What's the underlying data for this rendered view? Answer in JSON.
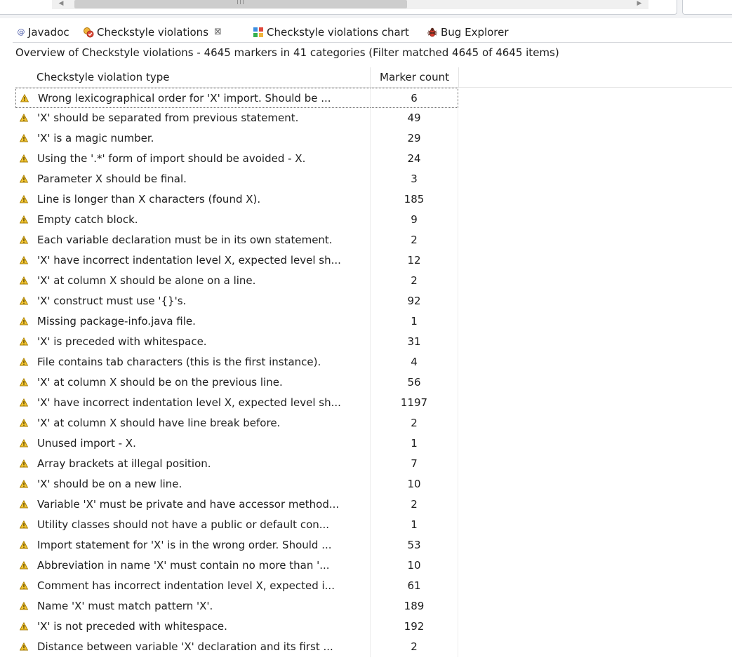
{
  "tabs": [
    {
      "label": "Javadoc",
      "icon": "at-sign-icon"
    },
    {
      "label": "Checkstyle violations",
      "icon": "checkstyle-icon",
      "active": true,
      "close": "⊠"
    },
    {
      "label": "Checkstyle violations chart",
      "icon": "chart-icon"
    },
    {
      "label": "Bug Explorer",
      "icon": "bug-icon"
    }
  ],
  "summary": "Overview of Checkstyle violations - 4645 markers in 41 categories (Filter matched 4645 of 4645 items)",
  "table": {
    "columns": [
      "Checkstyle violation type",
      "Marker count"
    ],
    "rows": [
      {
        "type": "Wrong lexicographical order for 'X' import. Should be ...",
        "count": "6"
      },
      {
        "type": "'X' should be separated from previous statement.",
        "count": "49"
      },
      {
        "type": "'X' is a magic number.",
        "count": "29"
      },
      {
        "type": "Using the '.*' form of import should be avoided - X.",
        "count": "24"
      },
      {
        "type": "Parameter X should be final.",
        "count": "3"
      },
      {
        "type": "Line is longer than X characters (found X).",
        "count": "185"
      },
      {
        "type": "Empty catch block.",
        "count": "9"
      },
      {
        "type": "Each variable declaration must be in its own statement.",
        "count": "2"
      },
      {
        "type": "'X' have incorrect indentation level X, expected level sh...",
        "count": "12"
      },
      {
        "type": "'X' at column X should be alone on a line.",
        "count": "2"
      },
      {
        "type": "'X' construct must use '{}'s.",
        "count": "92"
      },
      {
        "type": "Missing package-info.java file.",
        "count": "1"
      },
      {
        "type": "'X' is preceded with whitespace.",
        "count": "31"
      },
      {
        "type": "File contains tab characters (this is the first instance).",
        "count": "4"
      },
      {
        "type": "'X' at column X should be on the previous line.",
        "count": "56"
      },
      {
        "type": "'X' have incorrect indentation level X, expected level sh...",
        "count": "1197"
      },
      {
        "type": "'X' at column X should have line break before.",
        "count": "2"
      },
      {
        "type": "Unused import - X.",
        "count": "1"
      },
      {
        "type": "Array brackets at illegal position.",
        "count": "7"
      },
      {
        "type": "'X' should be on a new line.",
        "count": "10"
      },
      {
        "type": "Variable 'X' must be private and have accessor method...",
        "count": "2"
      },
      {
        "type": "Utility classes should not have a public or default con...",
        "count": "1"
      },
      {
        "type": "Import statement for 'X' is in the wrong order. Should ...",
        "count": "53"
      },
      {
        "type": "Abbreviation in name 'X' must contain no more than '...",
        "count": "10"
      },
      {
        "type": "Comment has incorrect indentation level X, expected i...",
        "count": "61"
      },
      {
        "type": "Name 'X' must match pattern 'X'.",
        "count": "189"
      },
      {
        "type": "'X' is not preceded with whitespace.",
        "count": "192"
      },
      {
        "type": "Distance between variable 'X' declaration and its first ...",
        "count": "2"
      }
    ]
  },
  "colors": {
    "warning_fill": "#f3c531",
    "warning_stroke": "#a47b00",
    "selection_border": "#666666"
  }
}
